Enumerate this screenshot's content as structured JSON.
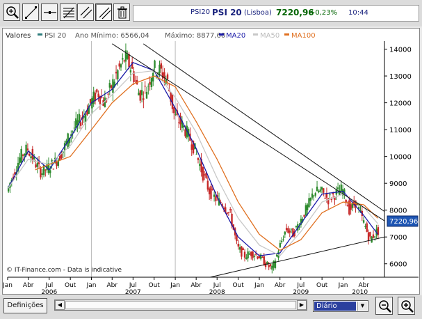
{
  "toolbar": {
    "tools": [
      {
        "name": "zoom-in-tool-icon"
      },
      {
        "name": "draw-line-tool-icon"
      },
      {
        "name": "horizontal-line-tool-icon"
      },
      {
        "name": "fibonacci-tool-icon"
      },
      {
        "name": "parallel-lines-tool-icon"
      },
      {
        "name": "trend-line-tool-icon",
        "active": true
      },
      {
        "name": "trash-icon"
      }
    ]
  },
  "quote": {
    "symbol": "PSI20",
    "name": "PSI 20",
    "exchange": "(Lisboa)",
    "price": "7220,96",
    "change": "+0,23%",
    "time": "10:44"
  },
  "legend": {
    "prefix": "Valores",
    "min_label": "Ano Mínimo: 6566,04",
    "max_label": "Máximo: 8877,60",
    "series_labels": [
      "PSI 20",
      "MA20",
      "MA50",
      "MA100"
    ]
  },
  "watermark": "© IT-Finance.com - Data is indicative",
  "price_tag": "7220,96",
  "bottom": {
    "settings_label": "Definições",
    "period_value": "Diário"
  },
  "colors": {
    "candle_up": "#2e8b2e",
    "candle_down": "#c62828",
    "ma20": "#1a1aa8",
    "ma50": "#c8c8c8",
    "ma100": "#e07020",
    "trend_line": "#111111",
    "price_tag_bg": "#1e56b4"
  },
  "chart_data": {
    "type": "line",
    "ylim": [
      5500,
      14300
    ],
    "yticks": [
      6000,
      7000,
      8000,
      9000,
      10000,
      11000,
      12000,
      13000,
      14000
    ],
    "ytick_labels": [
      "6000",
      "7000",
      "8000",
      "9000",
      "10000",
      "11000",
      "12000",
      "13000",
      "14000"
    ],
    "xlim": [
      "2006-01-01",
      "2010-06-30"
    ],
    "month_labels": [
      "Jan",
      "Abr",
      "Jul",
      "Out",
      "Jan",
      "Abr",
      "Jul",
      "Out",
      "Jan",
      "Abr",
      "Jul",
      "Out",
      "Jan",
      "Abr",
      "Jul",
      "Out",
      "Jan",
      "Abr"
    ],
    "month_dates": [
      "2006-01-01",
      "2006-04-01",
      "2006-07-01",
      "2006-10-01",
      "2007-01-01",
      "2007-04-01",
      "2007-07-01",
      "2007-10-01",
      "2008-01-01",
      "2008-04-01",
      "2008-07-01",
      "2008-10-01",
      "2009-01-01",
      "2009-04-01",
      "2009-07-01",
      "2009-10-01",
      "2010-01-01",
      "2010-04-01"
    ],
    "year_labels": [
      "2006",
      "2007",
      "2008",
      "2009",
      "2010"
    ],
    "year_label_dates": [
      "2006-07-01",
      "2007-07-01",
      "2008-07-01",
      "2009-07-01",
      "2010-03-15"
    ],
    "year_gridlines": [
      "2007-01-01",
      "2008-01-01"
    ],
    "series": [
      {
        "name": "PSI 20",
        "x": [
          "2006-01-01",
          "2006-02-01",
          "2006-03-01",
          "2006-04-01",
          "2006-05-01",
          "2006-06-01",
          "2006-07-01",
          "2006-08-01",
          "2006-09-01",
          "2006-10-01",
          "2006-11-01",
          "2006-12-01",
          "2007-01-01",
          "2007-02-01",
          "2007-03-01",
          "2007-04-01",
          "2007-05-01",
          "2007-06-01",
          "2007-07-01",
          "2007-08-01",
          "2007-09-01",
          "2007-10-01",
          "2007-11-01",
          "2007-12-01",
          "2008-01-01",
          "2008-02-01",
          "2008-03-01",
          "2008-04-01",
          "2008-05-01",
          "2008-06-01",
          "2008-07-01",
          "2008-08-01",
          "2008-09-01",
          "2008-10-01",
          "2008-11-01",
          "2008-12-01",
          "2009-01-01",
          "2009-02-01",
          "2009-03-01",
          "2009-04-01",
          "2009-05-01",
          "2009-06-01",
          "2009-07-01",
          "2009-08-01",
          "2009-09-01",
          "2009-10-01",
          "2009-11-01",
          "2009-12-01",
          "2010-01-01",
          "2010-02-01",
          "2010-03-01",
          "2010-04-01",
          "2010-05-01",
          "2010-06-01"
        ],
        "y": [
          8700,
          9400,
          10000,
          10300,
          9800,
          9400,
          9600,
          9800,
          10200,
          10800,
          11200,
          11500,
          12000,
          12400,
          12000,
          12600,
          13200,
          13700,
          13200,
          12300,
          12500,
          13300,
          13200,
          12800,
          11500,
          11200,
          10800,
          10200,
          9400,
          8700,
          8400,
          8200,
          7800,
          6600,
          6300,
          6400,
          6300,
          6000,
          5800,
          6600,
          7300,
          7100,
          7600,
          8100,
          8700,
          8700,
          8400,
          8600,
          8800,
          8000,
          8300,
          7600,
          6900,
          7220
        ]
      },
      {
        "name": "MA20",
        "x": [
          "2006-01-01",
          "2006-04-01",
          "2006-07-01",
          "2006-10-01",
          "2007-01-01",
          "2007-04-01",
          "2007-07-01",
          "2007-10-01",
          "2008-01-01",
          "2008-04-01",
          "2008-07-01",
          "2008-10-01",
          "2009-01-01",
          "2009-04-01",
          "2009-07-01",
          "2009-10-01",
          "2010-01-01",
          "2010-04-01",
          "2010-06-01"
        ],
        "y": [
          8800,
          10200,
          9500,
          10700,
          12000,
          12500,
          13500,
          13200,
          11800,
          10300,
          8500,
          7000,
          6300,
          6400,
          7500,
          8600,
          8700,
          7800,
          7100
        ]
      },
      {
        "name": "MA50",
        "x": [
          "2006-01-01",
          "2006-04-01",
          "2006-07-01",
          "2006-10-01",
          "2007-01-01",
          "2007-04-01",
          "2007-07-01",
          "2007-10-01",
          "2008-01-01",
          "2008-04-01",
          "2008-07-01",
          "2008-10-01",
          "2009-01-01",
          "2009-04-01",
          "2009-07-01",
          "2009-10-01",
          "2010-01-01",
          "2010-04-01",
          "2010-06-01"
        ],
        "y": [
          8800,
          9900,
          9700,
          10400,
          11600,
          12300,
          13100,
          13200,
          12200,
          10900,
          9200,
          7700,
          6700,
          6300,
          7200,
          8300,
          8600,
          8100,
          7500
        ]
      },
      {
        "name": "MA100",
        "x": [
          "2006-05-01",
          "2006-07-01",
          "2006-10-01",
          "2007-01-01",
          "2007-04-01",
          "2007-07-01",
          "2007-10-01",
          "2008-01-01",
          "2008-04-01",
          "2008-07-01",
          "2008-10-01",
          "2009-01-01",
          "2009-04-01",
          "2009-07-01",
          "2009-10-01",
          "2010-01-01",
          "2010-04-01",
          "2010-06-01"
        ],
        "y": [
          9500,
          9700,
          10000,
          11000,
          12000,
          12700,
          13000,
          12600,
          11300,
          9900,
          8300,
          7100,
          6500,
          6900,
          7900,
          8300,
          8200,
          7700
        ]
      },
      {
        "name": "Trend lines",
        "lines": [
          {
            "x": [
              "2007-04-01",
              "2010-06-30"
            ],
            "y": [
              14200,
              7600
            ]
          },
          {
            "x": [
              "2007-08-15",
              "2010-06-30"
            ],
            "y": [
              14200,
              7950
            ]
          },
          {
            "x": [
              "2008-06-01",
              "2010-06-30"
            ],
            "y": [
              5500,
              7000
            ]
          }
        ]
      }
    ]
  }
}
